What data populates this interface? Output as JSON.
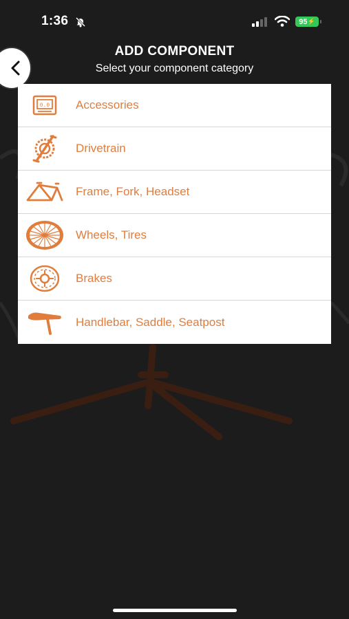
{
  "status_bar": {
    "time": "1:36",
    "battery": "95",
    "icons": [
      "bell-slash-icon",
      "cellular-signal-icon",
      "wifi-icon",
      "battery-icon"
    ],
    "battery_color": "#34c759"
  },
  "header": {
    "title": "ADD COMPONENT",
    "subtitle": "Select your component category"
  },
  "back_button": {
    "icon": "chevron-left-icon"
  },
  "accent_color": "#e07d3c",
  "categories": [
    {
      "label": "Accessories",
      "icon": "bike-computer-icon"
    },
    {
      "label": "Drivetrain",
      "icon": "crankset-icon"
    },
    {
      "label": "Frame, Fork, Headset",
      "icon": "bike-frame-icon"
    },
    {
      "label": "Wheels, Tires",
      "icon": "wheel-icon"
    },
    {
      "label": "Brakes",
      "icon": "brake-rotor-icon"
    },
    {
      "label": "Handlebar, Saddle, Seatpost",
      "icon": "saddle-icon"
    }
  ]
}
